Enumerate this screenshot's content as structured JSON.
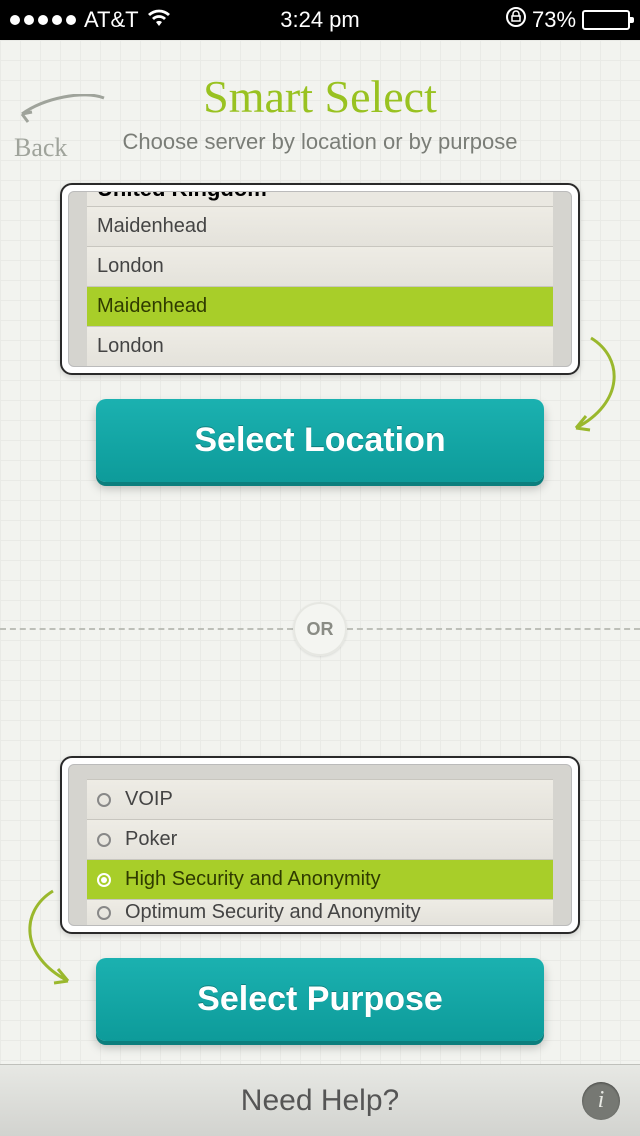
{
  "status": {
    "carrier": "AT&T",
    "time": "3:24 pm",
    "battery_pct": "73%"
  },
  "header": {
    "back": "Back",
    "title": "Smart Select",
    "subtitle": "Choose server by location or by purpose"
  },
  "location": {
    "group": "United Kingdom",
    "items": [
      "Maidenhead",
      "London",
      "Maidenhead",
      "London"
    ],
    "selected_index": 2,
    "button": "Select Location"
  },
  "divider": {
    "label": "OR"
  },
  "purpose": {
    "items": [
      "VOIP",
      "Poker",
      "High Security and Anonymity",
      "Optimum Security and Anonymity"
    ],
    "selected_index": 2,
    "button": "Select Purpose"
  },
  "footer": {
    "help": "Need Help?"
  }
}
